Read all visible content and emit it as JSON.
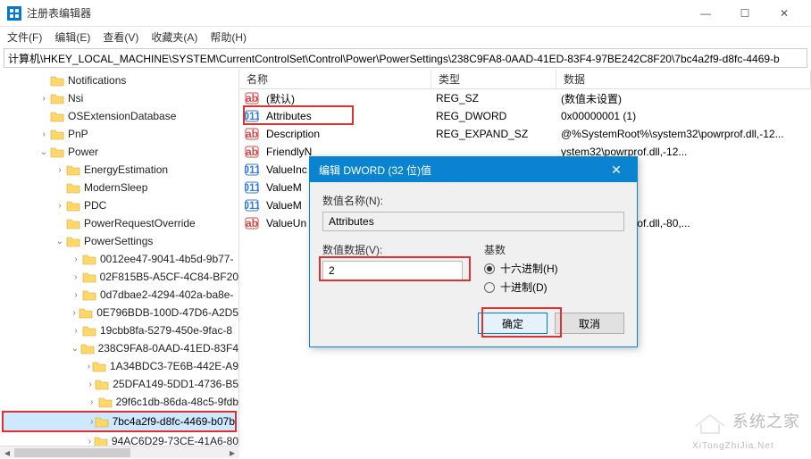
{
  "window": {
    "title": "注册表编辑器",
    "min": "—",
    "max": "☐",
    "close": "✕"
  },
  "menu": {
    "file": "文件(F)",
    "edit": "编辑(E)",
    "view": "查看(V)",
    "fav": "收藏夹(A)",
    "help": "帮助(H)"
  },
  "address": "计算机\\HKEY_LOCAL_MACHINE\\SYSTEM\\CurrentControlSet\\Control\\Power\\PowerSettings\\238C9FA8-0AAD-41ED-83F4-97BE242C8F20\\7bc4a2f9-d8fc-4469-b",
  "tree": [
    {
      "label": "Notifications",
      "indent": 42,
      "exp": ""
    },
    {
      "label": "Nsi",
      "indent": 42,
      "exp": ">"
    },
    {
      "label": "OSExtensionDatabase",
      "indent": 42,
      "exp": ""
    },
    {
      "label": "PnP",
      "indent": 42,
      "exp": ">"
    },
    {
      "label": "Power",
      "indent": 42,
      "exp": "v"
    },
    {
      "label": "EnergyEstimation",
      "indent": 60,
      "exp": ">"
    },
    {
      "label": "ModernSleep",
      "indent": 60,
      "exp": ""
    },
    {
      "label": "PDC",
      "indent": 60,
      "exp": ">"
    },
    {
      "label": "PowerRequestOverride",
      "indent": 60,
      "exp": ""
    },
    {
      "label": "PowerSettings",
      "indent": 60,
      "exp": "v"
    },
    {
      "label": "0012ee47-9041-4b5d-9b77-",
      "indent": 78,
      "exp": ">"
    },
    {
      "label": "02F815B5-A5CF-4C84-BF20",
      "indent": 78,
      "exp": ">"
    },
    {
      "label": "0d7dbae2-4294-402a-ba8e-",
      "indent": 78,
      "exp": ">"
    },
    {
      "label": "0E796BDB-100D-47D6-A2D5",
      "indent": 78,
      "exp": ">"
    },
    {
      "label": "19cbb8fa-5279-450e-9fac-8",
      "indent": 78,
      "exp": ">"
    },
    {
      "label": "238C9FA8-0AAD-41ED-83F4",
      "indent": 78,
      "exp": "v"
    },
    {
      "label": "1A34BDC3-7E6B-442E-A9",
      "indent": 96,
      "exp": ">"
    },
    {
      "label": "25DFA149-5DD1-4736-B5",
      "indent": 96,
      "exp": ">"
    },
    {
      "label": "29f6c1db-86da-48c5-9fdb",
      "indent": 96,
      "exp": ">"
    },
    {
      "label": "7bc4a2f9-d8fc-4469-b07b",
      "indent": 96,
      "exp": ">",
      "selected": true
    },
    {
      "label": "94AC6D29-73CE-41A6-80",
      "indent": 96,
      "exp": ">"
    }
  ],
  "list": {
    "cols": {
      "name": "名称",
      "type": "类型",
      "data": "数据"
    },
    "rows": [
      {
        "icon": "str",
        "name": "(默认)",
        "type": "REG_SZ",
        "data": "(数值未设置)"
      },
      {
        "icon": "bin",
        "name": "Attributes",
        "type": "REG_DWORD",
        "data": "0x00000001 (1)",
        "hl": true
      },
      {
        "icon": "str",
        "name": "Description",
        "type": "REG_EXPAND_SZ",
        "data": "@%SystemRoot%\\system32\\powrprof.dll,-12..."
      },
      {
        "icon": "str",
        "name": "FriendlyN",
        "type": "",
        "data": "ystem32\\powrprof.dll,-12..."
      },
      {
        "icon": "bin",
        "name": "ValueInc",
        "type": "",
        "data": ""
      },
      {
        "icon": "bin",
        "name": "ValueM",
        "type": "",
        "data": ""
      },
      {
        "icon": "bin",
        "name": "ValueM",
        "type": "",
        "data": ""
      },
      {
        "icon": "str",
        "name": "ValueUn",
        "type": "",
        "data": "ystem32\\powrprof.dll,-80,..."
      }
    ]
  },
  "dialog": {
    "title": "编辑 DWORD (32 位)值",
    "name_label": "数值名称(N):",
    "name_value": "Attributes",
    "data_label": "数值数据(V):",
    "data_value": "2",
    "base_label": "基数",
    "hex": "十六进制(H)",
    "dec": "十进制(D)",
    "ok": "确定",
    "cancel": "取消"
  },
  "watermark": {
    "brand": "系统之家",
    "url": "XiTongZhiJia.Net"
  }
}
